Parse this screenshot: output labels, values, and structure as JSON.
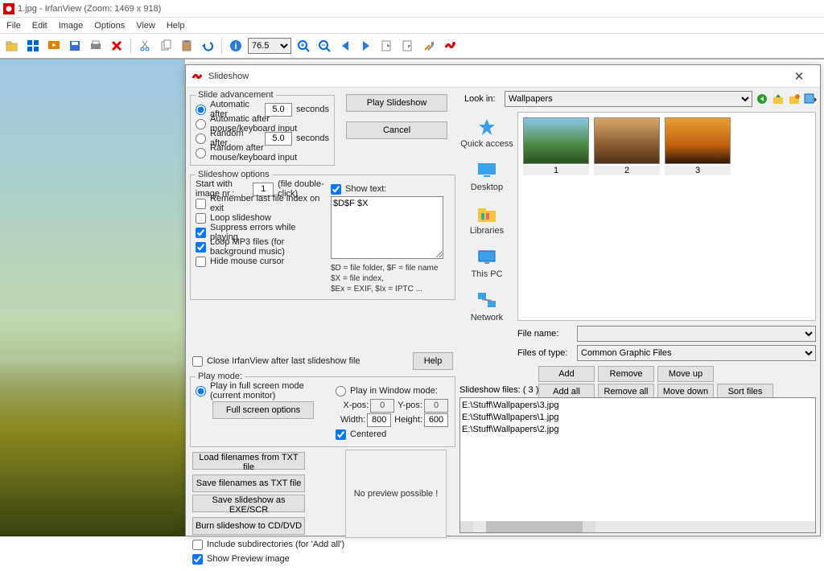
{
  "titlebar": "1.jpg - IrfanView (Zoom: 1469 x 918)",
  "menu": [
    "File",
    "Edit",
    "Image",
    "Options",
    "View",
    "Help"
  ],
  "toolbar": {
    "zoom": "76.5"
  },
  "dialog_title": "Slideshow",
  "slide_adv": {
    "legend": "Slide advancement",
    "auto_after": "Automatic after",
    "auto_val": "5.0",
    "seconds": "seconds",
    "auto_mk": "Automatic after mouse/keyboard input",
    "rand_after": "Random   after",
    "rand_val": "5.0",
    "rand_mk": "Random   after mouse/keyboard input"
  },
  "buttons": {
    "play": "Play Slideshow",
    "cancel": "Cancel",
    "help": "Help",
    "fullscreen": "Full screen options",
    "load_txt": "Load filenames from TXT file",
    "save_txt": "Save filenames as TXT file",
    "save_exe": "Save slideshow as  EXE/SCR",
    "burn": "Burn slideshow to CD/DVD",
    "add": "Add",
    "remove": "Remove",
    "moveup": "Move up",
    "addall": "Add all",
    "removeall": "Remove all",
    "movedown": "Move down",
    "sort": "Sort files"
  },
  "options": {
    "legend": "Slideshow options",
    "start_lbl": "Start with image nr.:",
    "start_val": "1",
    "start_suffix": "(file double-click)",
    "remember": "Remember last file index on exit",
    "loop": "Loop slideshow",
    "suppress": "Suppress errors while playing",
    "loop_mp3": "Loop MP3 files (for background music)",
    "hide_cursor": "Hide mouse cursor",
    "show_text": "Show text:",
    "text_val": "$D$F $X",
    "legend_keys": "$D = file folder, $F = file name\n$X = file index,\n$Ex = EXIF, $Ix = IPTC ..."
  },
  "close_after": "Close IrfanView after last slideshow file",
  "playmode": {
    "legend": "Play mode:",
    "full": "Play in full screen mode (current monitor)",
    "window": "Play in Window mode:",
    "xpos": "X-pos:",
    "xv": "0",
    "ypos": "Y-pos:",
    "yv": "0",
    "width": "Width:",
    "wv": "800",
    "height": "Height:",
    "hv": "600",
    "centered": "Centered"
  },
  "include_sub": "Include subdirectories (for 'Add all')",
  "show_preview": "Show Preview image",
  "preview_text": "No preview possible !",
  "lookin_lbl": "Look in:",
  "lookin_val": "Wallpapers",
  "places": [
    "Quick access",
    "Desktop",
    "Libraries",
    "This PC",
    "Network"
  ],
  "thumbs": [
    "1",
    "2",
    "3"
  ],
  "filename_lbl": "File name:",
  "filename_val": "",
  "filetype_lbl": "Files of type:",
  "filetype_val": "Common Graphic Files",
  "slideshow_files_lbl": "Slideshow files:   ( 3 )",
  "files": [
    "E:\\Stuff\\Wallpapers\\3.jpg",
    "E:\\Stuff\\Wallpapers\\1.jpg",
    "E:\\Stuff\\Wallpapers\\2.jpg"
  ]
}
